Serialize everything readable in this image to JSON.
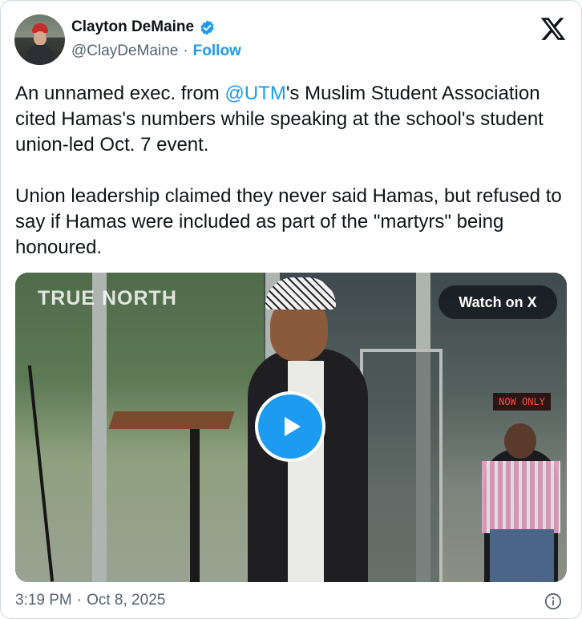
{
  "author": {
    "name": "Clayton DeMaine",
    "handle": "@ClayDeMaine",
    "separator": "·",
    "follow_label": "Follow",
    "verified_icon": "verified-badge-icon"
  },
  "post": {
    "p1_before": "An unnamed exec. from ",
    "mention": "@UTM",
    "p1_after": "'s Muslim Student Association cited Hamas's numbers while speaking at the school's student union-led Oct. 7 event.",
    "p2": "Union leadership claimed they never said Hamas, but refused to say if Hamas were included as part of the \"martyrs\" being honoured."
  },
  "media": {
    "watermark": "TRUE NORTH",
    "watch_label": "Watch on X",
    "sign_text": "NOW ONLY",
    "play_icon": "play-icon"
  },
  "meta": {
    "time": "3:19 PM",
    "separator": "·",
    "date": "Oct 8, 2025"
  },
  "colors": {
    "accent": "#1d9bf0",
    "text": "#0f1419",
    "secondary": "#536471"
  }
}
